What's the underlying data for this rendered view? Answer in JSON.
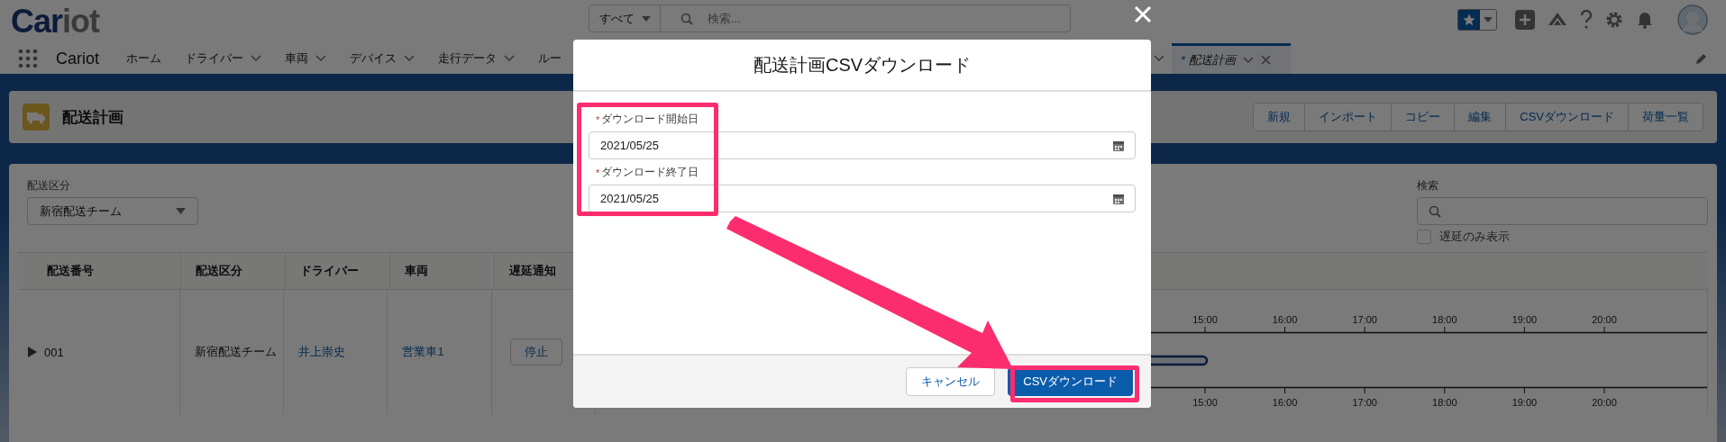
{
  "header": {
    "logo_dark": "Car",
    "logo_light": "iot",
    "search_scope": "すべて",
    "search_placeholder": "検索..."
  },
  "nav": {
    "app_name": "Cariot",
    "items": [
      {
        "label": "ホーム",
        "dropdown": false,
        "selected": false
      },
      {
        "label": "ドライバー",
        "dropdown": true,
        "selected": false
      },
      {
        "label": "車両",
        "dropdown": true,
        "selected": false
      },
      {
        "label": "デバイス",
        "dropdown": true,
        "selected": false
      },
      {
        "label": "走行データ",
        "dropdown": true,
        "selected": false
      },
      {
        "label": "ルー",
        "dropdown": false,
        "selected": false
      }
    ],
    "open_tab": {
      "mark": "*",
      "label": "配送計画",
      "selected": true
    }
  },
  "page_header": {
    "title": "配送計画",
    "buttons": [
      "新規",
      "インポート",
      "コピー",
      "編集",
      "CSVダウンロード",
      "荷量一覧"
    ]
  },
  "filters": {
    "category_label": "配送区分",
    "category_value": "新宿配送チーム",
    "search_label": "検索",
    "delay_only": {
      "label": "遅延のみ表示",
      "checked": false
    }
  },
  "table": {
    "columns": [
      "配送番号",
      "配送区分",
      "ドライバー",
      "車両",
      "遅延通知"
    ],
    "rows": [
      {
        "number": "001",
        "expanded": false,
        "category": "新宿配送チーム",
        "driver": "井上崇史",
        "vehicle": "営業車1",
        "delay_button": "停止"
      }
    ]
  },
  "timeline": {
    "hours_top": [
      "15:00",
      "16:00",
      "17:00",
      "18:00",
      "19:00",
      "20:00"
    ],
    "hours_bottom": [
      "15:00",
      "16:00",
      "17:00",
      "18:00",
      "19:00",
      "20:00"
    ]
  },
  "modal": {
    "title": "配送計画CSVダウンロード",
    "fields": [
      {
        "label": "ダウンロード開始日",
        "required": true,
        "required_mark": "*",
        "value": "2021/05/25"
      },
      {
        "label": "ダウンロード終了日",
        "required": true,
        "required_mark": "*",
        "value": "2021/05/25"
      }
    ],
    "buttons": [
      {
        "label": "キャンセル",
        "kind": "neutral"
      },
      {
        "label": "CSVダウンロード",
        "kind": "brand"
      }
    ]
  }
}
